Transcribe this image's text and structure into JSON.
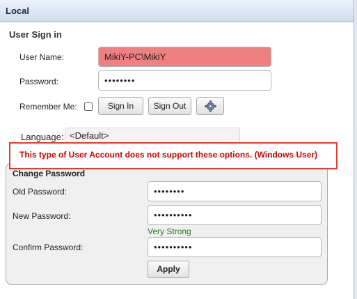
{
  "header": {
    "title": "Local"
  },
  "sign_in": {
    "title": "User Sign in",
    "username_label": "User Name:",
    "username_value": "MikiY-PC\\MikiY",
    "password_label": "Password:",
    "password_value": "••••••••",
    "remember_label": "Remember Me:",
    "remember_checked": false,
    "sign_in_label": "Sign In",
    "sign_out_label": "Sign Out",
    "settings_icon": "gear-icon",
    "language_label": "Language:",
    "language_value": "<Default>"
  },
  "warning": {
    "text": "This type of User Account does not support these options. (Windows User)",
    "color": "#e53935"
  },
  "change_password": {
    "title": "Change Password",
    "old_label": "Old Password:",
    "old_value": "••••••••",
    "new_label": "New Password:",
    "new_value": "••••••••••",
    "strength": "Very Strong",
    "confirm_label": "Confirm Password:",
    "confirm_value": "••••••••••",
    "apply_label": "Apply"
  },
  "colors": {
    "username_bg": "#f08080",
    "strength": "#1e7a1e",
    "header_bg": "#cfdcec"
  }
}
